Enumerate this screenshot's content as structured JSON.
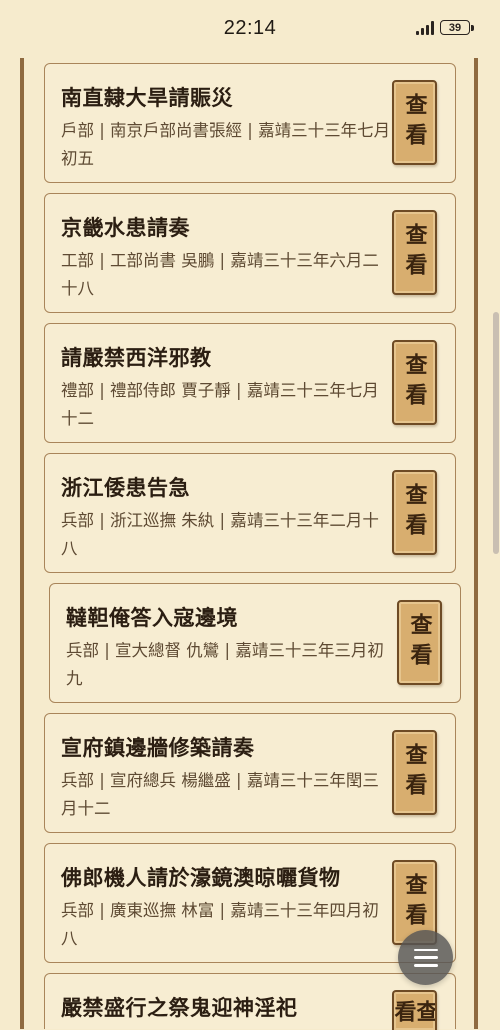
{
  "status_bar": {
    "time": "22:14",
    "battery": "39",
    "icons": [
      "signal-icon",
      "battery-icon"
    ]
  },
  "memorials": [
    {
      "title": "南直隸大旱請賑災",
      "meta": "戶部 | 南京戶部尚書張經 | 嘉靖三十三年七月初五",
      "button_label": "查看"
    },
    {
      "title": "京畿水患請奏",
      "meta": "工部 | 工部尚書 吳鵬 | 嘉靖三十三年六月二十八",
      "button_label": "查看"
    },
    {
      "title": "請嚴禁西洋邪教",
      "meta": "禮部 | 禮部侍郎 賈子靜 | 嘉靖三十三年七月十二",
      "button_label": "查看"
    },
    {
      "title": "浙江倭患告急",
      "meta": "兵部 | 浙江巡撫 朱紈 | 嘉靖三十三年二月十八",
      "button_label": "查看"
    },
    {
      "title": "韃靼俺答入寇邊境",
      "meta": "兵部 | 宣大總督 仇鸞 | 嘉靖三十三年三月初九",
      "button_label": "查看"
    },
    {
      "title": "宣府鎮邊牆修築請奏",
      "meta": "兵部 | 宣府總兵 楊繼盛 | 嘉靖三十三年閏三月十二",
      "button_label": "查看"
    },
    {
      "title": "佛郎機人請於濠鏡澳晾曬貨物",
      "meta": "兵部 | 廣東巡撫 林富 | 嘉靖三十三年四月初八",
      "button_label": "查看"
    },
    {
      "title": "嚴禁盛行之祭鬼迎神淫祀",
      "meta": "",
      "button_label": "查看"
    }
  ],
  "menu_button": {
    "icon": "menu-icon"
  },
  "colors": {
    "background": "#f6ebcd",
    "card_border": "#a9855a",
    "button_fill": "#d8ae6f",
    "button_border": "#6e4b25",
    "frame": "#8f6a40"
  }
}
